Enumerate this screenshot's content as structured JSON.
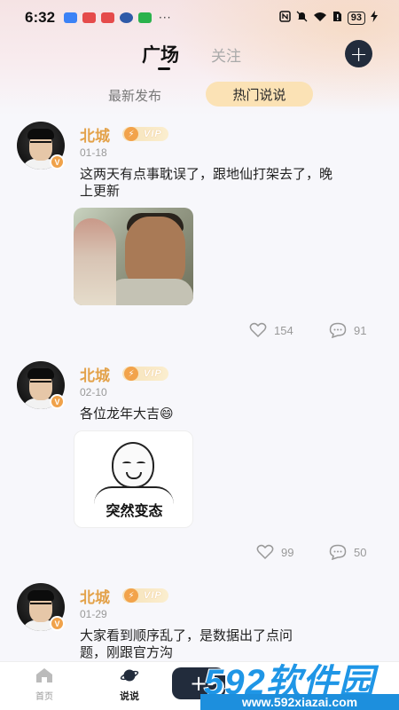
{
  "status_bar": {
    "time": "6:32",
    "more": "···",
    "battery": "93"
  },
  "header": {
    "tab_active": "广场",
    "tab_inactive": "关注",
    "add_label": "+"
  },
  "sub_tabs": {
    "latest": "最新发布",
    "hot": "热门说说"
  },
  "posts": [
    {
      "username": "北城",
      "vip": "VIP",
      "date": "01-18",
      "text": "这两天有点事耽误了，跟地仙打架去了，晚上更新",
      "likes": "154",
      "comments": "91"
    },
    {
      "username": "北城",
      "vip": "VIP",
      "date": "02-10",
      "text": "各位龙年大吉😄",
      "image_caption": "突然变态",
      "likes": "99",
      "comments": "50"
    },
    {
      "username": "北城",
      "vip": "VIP",
      "date": "01-29",
      "text": "大家看到顺序乱了，是数据出了点问题，刚跟官方沟"
    }
  ],
  "bottom_nav": {
    "home": "首页",
    "shuoshuo": "说说",
    "publish": "+"
  },
  "watermark": {
    "big": "592软件园",
    "small": "www.592xiazai.com"
  },
  "colors": {
    "accent_dark": "#222c3c",
    "username": "#e3a24a",
    "hot_tab_bg": "#fbe2b5",
    "watermark_blue": "#1f96e6"
  }
}
